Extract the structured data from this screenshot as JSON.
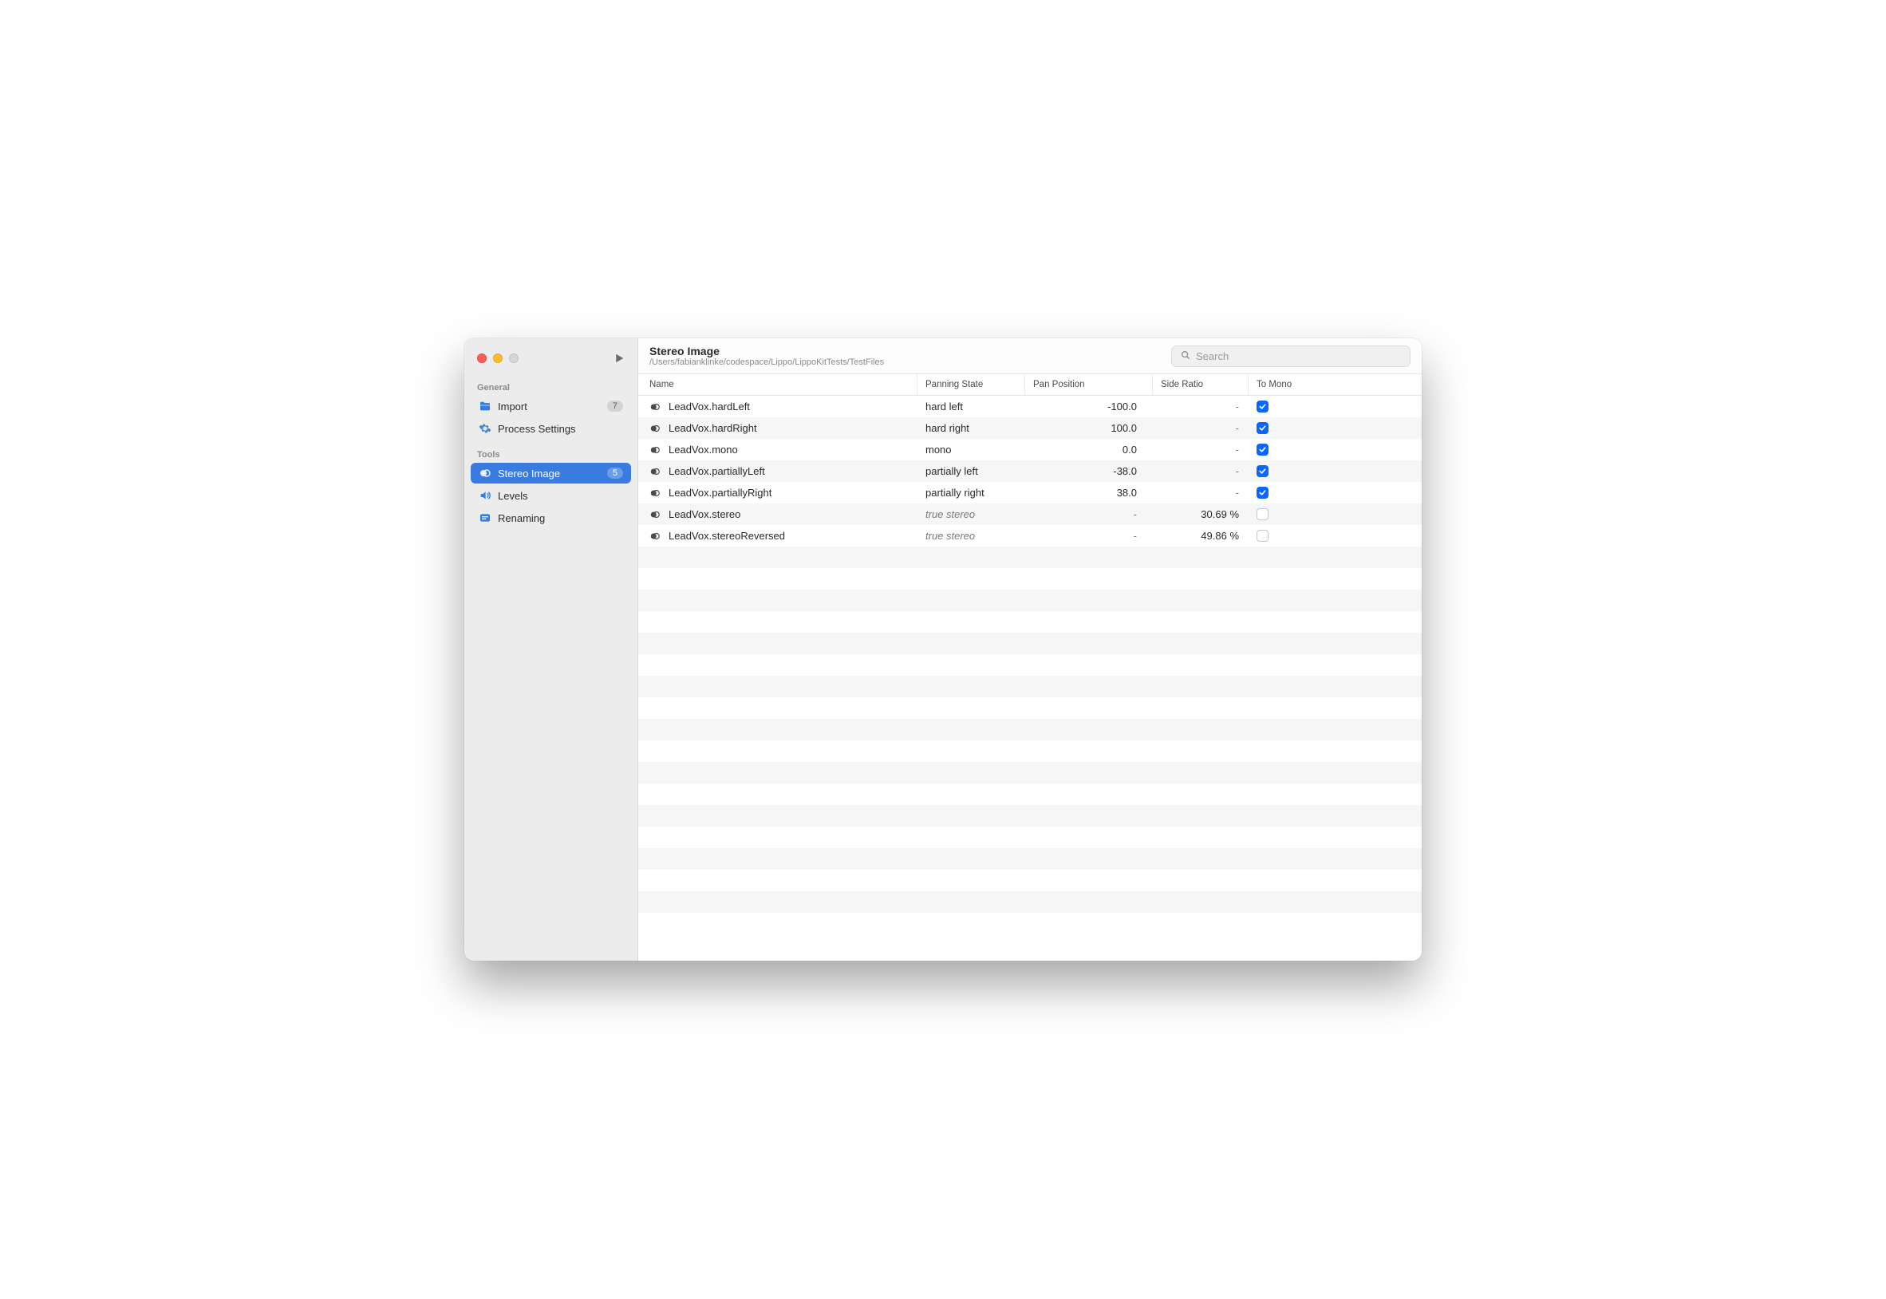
{
  "window_controls": {
    "has_close": true,
    "has_minimize": true,
    "has_zoom": false
  },
  "sidebar": {
    "sections": [
      {
        "label": "General",
        "items": [
          {
            "id": "import",
            "label": "Import",
            "icon": "folder",
            "badge": "7",
            "selected": false
          },
          {
            "id": "process",
            "label": "Process Settings",
            "icon": "gears",
            "badge": null,
            "selected": false
          }
        ]
      },
      {
        "label": "Tools",
        "items": [
          {
            "id": "stereo",
            "label": "Stereo Image",
            "icon": "stereo",
            "badge": "5",
            "selected": true
          },
          {
            "id": "levels",
            "label": "Levels",
            "icon": "speaker",
            "badge": null,
            "selected": false
          },
          {
            "id": "renaming",
            "label": "Renaming",
            "icon": "text",
            "badge": null,
            "selected": false
          }
        ]
      }
    ]
  },
  "header": {
    "title": "Stereo Image",
    "subtitle": "/Users/fabianklinke/codespace/Lippo/LippoKitTests/TestFiles"
  },
  "search": {
    "placeholder": "Search"
  },
  "columns": {
    "name": "Name",
    "panning_state": "Panning State",
    "pan_position": "Pan Position",
    "side_ratio": "Side Ratio",
    "to_mono": "To Mono"
  },
  "rows": [
    {
      "name": "LeadVox.hardLeft",
      "state": "hard left",
      "state_italic": false,
      "pos": "-100.0",
      "ratio": "-",
      "mono": true
    },
    {
      "name": "LeadVox.hardRight",
      "state": "hard right",
      "state_italic": false,
      "pos": "100.0",
      "ratio": "-",
      "mono": true
    },
    {
      "name": "LeadVox.mono",
      "state": "mono",
      "state_italic": false,
      "pos": "0.0",
      "ratio": "-",
      "mono": true
    },
    {
      "name": "LeadVox.partiallyLeft",
      "state": "partially left",
      "state_italic": false,
      "pos": "-38.0",
      "ratio": "-",
      "mono": true
    },
    {
      "name": "LeadVox.partiallyRight",
      "state": "partially right",
      "state_italic": false,
      "pos": "38.0",
      "ratio": "-",
      "mono": true
    },
    {
      "name": "LeadVox.stereo",
      "state": "true stereo",
      "state_italic": true,
      "pos": "-",
      "ratio": "30.69 %",
      "mono": false
    },
    {
      "name": "LeadVox.stereoReversed",
      "state": "true stereo",
      "state_italic": true,
      "pos": "-",
      "ratio": "49.86 %",
      "mono": false
    }
  ]
}
